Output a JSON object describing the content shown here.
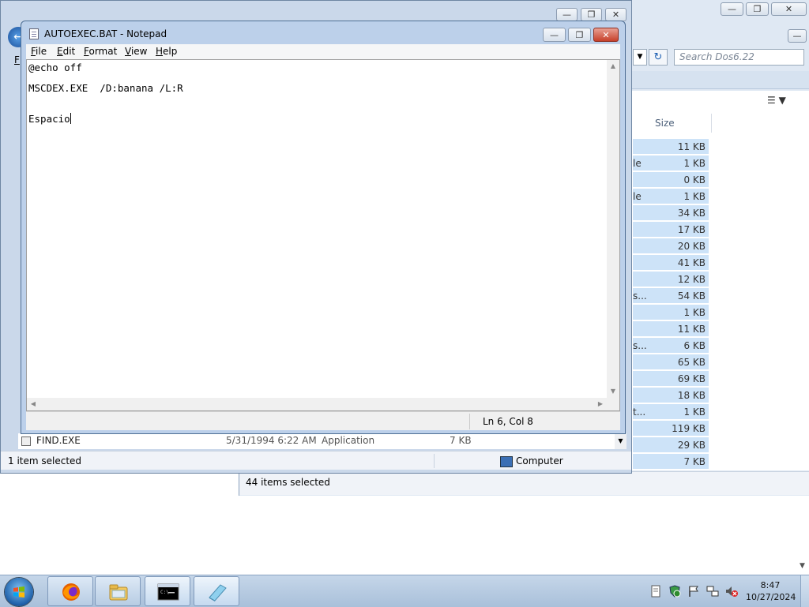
{
  "notepad": {
    "title": "AUTOEXEC.BAT - Notepad",
    "menu": [
      {
        "hotkey": "F",
        "rest": "ile"
      },
      {
        "hotkey": "E",
        "rest": "dit"
      },
      {
        "hotkey": "F",
        "rest": "ormat"
      },
      {
        "hotkey": "V",
        "rest": "iew"
      },
      {
        "hotkey": "H",
        "rest": "elp"
      }
    ],
    "lines": [
      "@echo off",
      "",
      "MSCDEX.EXE  /D:banana /L:R",
      "",
      "",
      "Espacio"
    ],
    "status_position": "Ln 6, Col 8"
  },
  "explorer_front": {
    "menu_fragment": "F",
    "row": {
      "name": "FIND.EXE",
      "date": "5/31/1994 6:22 AM",
      "type": "Application",
      "size": "7 KB"
    },
    "status_left": "1 item selected",
    "status_right": "Computer"
  },
  "explorer_back": {
    "search_placeholder": "Search Dos6.22",
    "size_header": "Size",
    "rows": [
      {
        "frag": "",
        "size": "11 KB"
      },
      {
        "frag": "le",
        "size": "1 KB"
      },
      {
        "frag": "",
        "size": "0 KB"
      },
      {
        "frag": "le",
        "size": "1 KB"
      },
      {
        "frag": "",
        "size": "34 KB"
      },
      {
        "frag": "",
        "size": "17 KB"
      },
      {
        "frag": "",
        "size": "20 KB"
      },
      {
        "frag": "",
        "size": "41 KB"
      },
      {
        "frag": "",
        "size": "12 KB"
      },
      {
        "frag": "s...",
        "size": "54 KB"
      },
      {
        "frag": "",
        "size": "1 KB"
      },
      {
        "frag": "",
        "size": "11 KB"
      },
      {
        "frag": "s...",
        "size": "6 KB"
      },
      {
        "frag": "",
        "size": "65 KB"
      },
      {
        "frag": "",
        "size": "69 KB"
      },
      {
        "frag": "",
        "size": "18 KB"
      },
      {
        "frag": "t...",
        "size": "1 KB"
      },
      {
        "frag": "",
        "size": "119 KB"
      },
      {
        "frag": "",
        "size": "29 KB"
      },
      {
        "frag": "",
        "size": "7 KB"
      }
    ],
    "status": "44 items selected"
  },
  "taskbar": {
    "clock_time": "8:47",
    "clock_date": "10/27/2024"
  }
}
